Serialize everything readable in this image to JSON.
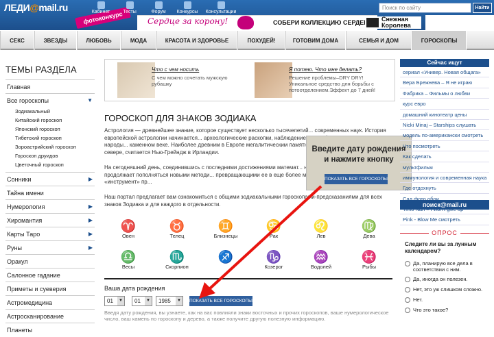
{
  "header": {
    "logo_pre": "ЛЕДИ",
    "logo_at": "@",
    "logo_post": "mail.ru",
    "badge": "фотоконкурс",
    "nav": [
      "Кабинет",
      "Тесты",
      "Форум",
      "Конкурсы",
      "Консультации"
    ],
    "search_placeholder": "Поиск по сайту",
    "search_btn": "Найти"
  },
  "banner": {
    "slogan": "Сердце за корону!",
    "collect": "СОБЕРИ КОЛЛЕКЦИЮ СЕРДЕЦ",
    "brand_line1": "Снежная",
    "brand_line2": "Королева"
  },
  "menu": [
    "СЕКС",
    "ЗВЕЗДЫ",
    "ЛЮБОВЬ",
    "МОДА",
    "КРАСОТА И ЗДОРОВЬЕ",
    "ПОХУДЕЙ!",
    "ГОТОВИМ ДОМА",
    "СЕМЬЯ И ДОМ",
    "ГОРОСКОПЫ"
  ],
  "sidebar": {
    "title": "ТЕМЫ РАЗДЕЛА",
    "main": "Главная",
    "all": "Все гороскопы",
    "subs": [
      "Зодиакальный",
      "Китайский гороскоп",
      "Японский гороскоп",
      "Тибетский гороскоп",
      "Зороастрийский гороскоп",
      "Гороскоп друидов",
      "Цветочный гороскоп"
    ],
    "items": [
      "Сонники",
      "Тайна имени",
      "Нумерология",
      "Хиромантия",
      "Карты Таро",
      "Руны",
      "Оракул",
      "Салонное гадание",
      "Приметы и суеверия",
      "Астромедицина",
      "Астросканирование",
      "Планеты"
    ]
  },
  "promo": [
    {
      "title": "Что с чем носить",
      "text": "С чем можно сочетать мужскую рубашку"
    },
    {
      "title": "Я потею. Что мне делать?",
      "text": "Решение проблемы–DRY DRY! Уникальное средство для борьбы с потоотделением.Эффект до 7 дней!"
    }
  ],
  "article": {
    "title": "ГОРОСКОП ДЛЯ ЗНАКОВ ЗОДИАКА",
    "p1": "Астрология — древнейшее знание, которое существует несколько тысячелетий... современных наук. История европейской астрологии начинается... археологические раскопки, наблюдением за небесными светилами народы... каменном веке. Наиболее древним в Европе мегалитическим памятником... к югу от Белфаста на севере, считается Нью-Грейндж в Ирландии.",
    "p2": "На сегодняшний день, соединившись с последними достижениями математ... науки, астрология обогатилась и продолжает пополняться новыми методи... превращающими ее в еще более мощный эзотерический «инструмент» пр...",
    "p3": "Наш портал предлагает вам ознакомиться с общими зодиакальными гороскопами-предсказаниями для всех знаков Зодиака и для каждого в отдельности."
  },
  "overlay": {
    "text": "Введите дату рождения и нажмите кнопку",
    "button": "ПОКАЗАТЬ ВСЕ ГОРОСКОПЫ"
  },
  "zodiac": [
    {
      "g": "♈",
      "n": "Овен"
    },
    {
      "g": "♉",
      "n": "Телец"
    },
    {
      "g": "♊",
      "n": "Близнецы"
    },
    {
      "g": "♋",
      "n": "Рак"
    },
    {
      "g": "♌",
      "n": "Лев"
    },
    {
      "g": "♍",
      "n": "Дева"
    },
    {
      "g": "♎",
      "n": "Весы"
    },
    {
      "g": "♏",
      "n": "Скорпион"
    },
    {
      "g": "♐",
      "n": ""
    },
    {
      "g": "♑",
      "n": "Козерог"
    },
    {
      "g": "♒",
      "n": "Водолей"
    },
    {
      "g": "♓",
      "n": "Рыбы"
    }
  ],
  "birth": {
    "label": "Ваша дата рождения",
    "day": "01",
    "month": "01",
    "year": "1985",
    "button": "ПОКАЗАТЬ ВСЕ ГОРОСКОПЫ",
    "disclaimer": "Введя дату рождения, вы узнаете, как на вас повлияли знаки восточных и прочих гороскопов, ваше нумерологическое число, ваш камень по гороскопу и дерево, а также получите другую полезную информацию."
  },
  "right": {
    "header": "Сейчас ищут",
    "items": [
      "сериал «Универ. Новая общага»",
      "Вера Брежнева – Я не играю",
      "Фабрика – Фильмы о любви",
      "курс евро",
      "домашний кинотеатр цены",
      "Nicki Minaj – Starships слушать",
      "модель по-американски смотреть",
      "Что посмотреть",
      "Как сделать",
      "мультфильм",
      "иммунология и современная наука",
      "Где отдохнуть",
      "Сад фото обои",
      "Timo Nan – I won't give up",
      "Pink - Blow Me смотреть"
    ],
    "poisk": "поиск@mail.ru",
    "poll_title": "ОПРОС",
    "poll_q": "Следите ли вы за лунным календарем?",
    "poll_opts": [
      "Да, планирую все дела в соответствии с ним.",
      "Да, иногда он полезен.",
      "Нет, это уж слишком сложно.",
      "Нет.",
      "Что это такое?"
    ]
  },
  "colors": {
    "brand": "#1c4f8c",
    "accent": "#e57200",
    "poll": "#d21f2f",
    "arrow": "#e8140f"
  }
}
